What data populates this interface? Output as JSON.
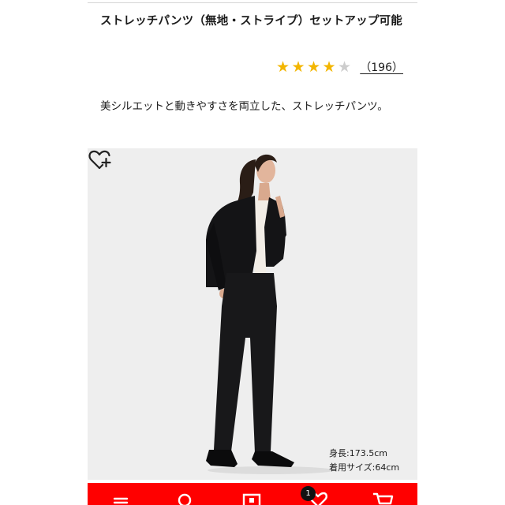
{
  "product": {
    "title": "ストレッチパンツ（無地・ストライプ）セットアップ可能",
    "rating": {
      "stars_filled": 4,
      "stars_total": 5,
      "review_count_label": "（196）"
    },
    "description": "美シルエットと動きやすさを両立した、ストレッチパンツ。"
  },
  "hero_image": {
    "favorite_icon": "heart-plus-icon",
    "model_height": "身長:173.5cm",
    "model_size": "着用サイズ:64cm"
  },
  "bottom_nav": {
    "items": [
      "menu-icon",
      "search-icon",
      "store-icon",
      "heart-icon",
      "cart-icon"
    ],
    "cart_count": "1"
  },
  "colors": {
    "accent_red": "#ff0000",
    "star_gold": "#f3b600",
    "star_empty": "#cdcdcd",
    "image_background": "#eeeeee"
  }
}
